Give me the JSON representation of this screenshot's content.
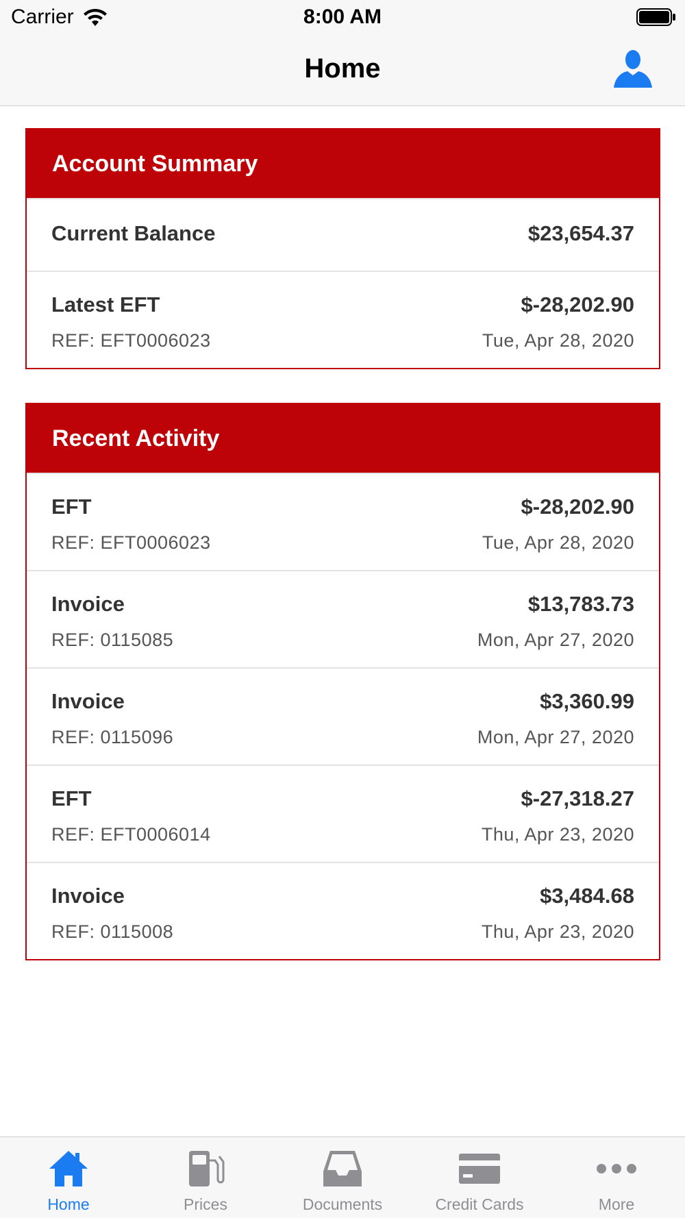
{
  "status_bar": {
    "carrier": "Carrier",
    "time": "8:00 AM"
  },
  "nav": {
    "title": "Home",
    "profile_icon": "person-icon"
  },
  "account_summary": {
    "header": "Account Summary",
    "current_balance": {
      "label": "Current Balance",
      "amount": "$23,654.37"
    },
    "latest_eft": {
      "label": "Latest EFT",
      "amount": "$-28,202.90",
      "ref": "REF: EFT0006023",
      "date": "Tue, Apr 28, 2020"
    }
  },
  "recent_activity": {
    "header": "Recent Activity",
    "items": [
      {
        "type": "EFT",
        "amount": "$-28,202.90",
        "ref": "REF: EFT0006023",
        "date": "Tue, Apr 28, 2020"
      },
      {
        "type": "Invoice",
        "amount": "$13,783.73",
        "ref": "REF: 0115085",
        "date": "Mon, Apr 27, 2020"
      },
      {
        "type": "Invoice",
        "amount": "$3,360.99",
        "ref": "REF: 0115096",
        "date": "Mon, Apr 27, 2020"
      },
      {
        "type": "EFT",
        "amount": "$-27,318.27",
        "ref": "REF: EFT0006014",
        "date": "Thu, Apr 23, 2020"
      },
      {
        "type": "Invoice",
        "amount": "$3,484.68",
        "ref": "REF: 0115008",
        "date": "Thu, Apr 23, 2020"
      }
    ]
  },
  "tabs": [
    {
      "label": "Home",
      "icon": "home-icon",
      "active": true
    },
    {
      "label": "Prices",
      "icon": "fuel-pump-icon",
      "active": false
    },
    {
      "label": "Documents",
      "icon": "inbox-tray-icon",
      "active": false
    },
    {
      "label": "Credit Cards",
      "icon": "credit-card-icon",
      "active": false
    },
    {
      "label": "More",
      "icon": "more-dots-icon",
      "active": false
    }
  ],
  "colors": {
    "brand_red": "#bd0208",
    "active_tab": "#1a7cf0",
    "inactive_tab": "#8e8e93"
  }
}
